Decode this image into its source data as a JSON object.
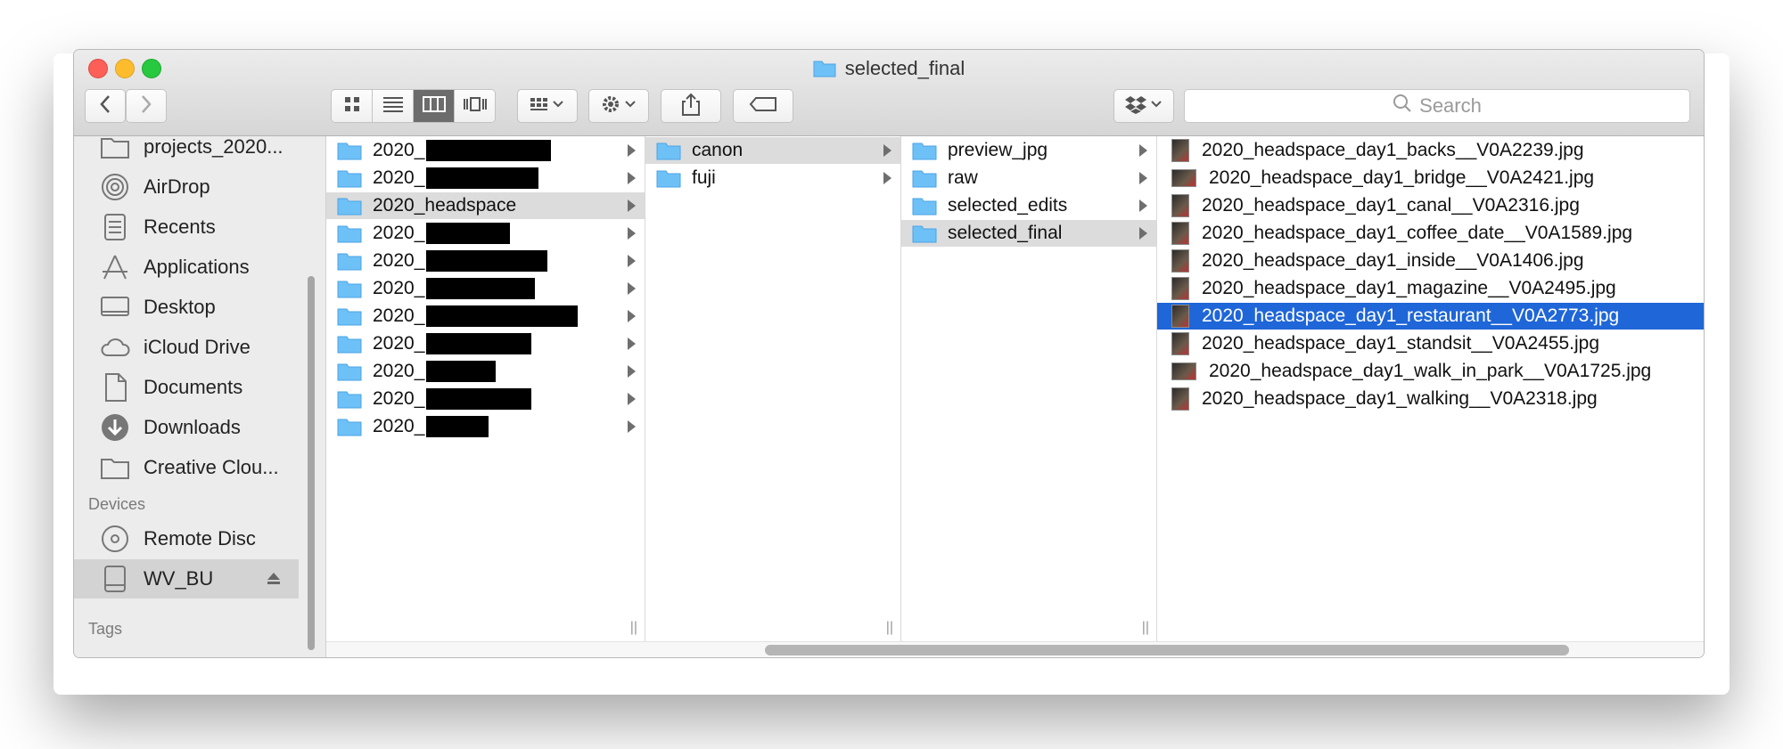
{
  "window": {
    "title": "selected_final"
  },
  "toolbar": {
    "back_icon": "chevron-left-icon",
    "forward_icon": "chevron-right-icon",
    "view_modes": [
      "icon-view-icon",
      "list-view-icon",
      "column-view-icon",
      "cover-flow-icon"
    ],
    "active_view": "column",
    "search_placeholder": "Search"
  },
  "sidebar": {
    "items": [
      {
        "label": "projects_2020...",
        "icon": "folder-icon"
      },
      {
        "label": "AirDrop",
        "icon": "airdrop-icon"
      },
      {
        "label": "Recents",
        "icon": "recents-icon"
      },
      {
        "label": "Applications",
        "icon": "applications-icon"
      },
      {
        "label": "Desktop",
        "icon": "desktop-icon"
      },
      {
        "label": "iCloud Drive",
        "icon": "cloud-icon"
      },
      {
        "label": "Documents",
        "icon": "documents-icon"
      },
      {
        "label": "Downloads",
        "icon": "downloads-icon"
      },
      {
        "label": "Creative Clou...",
        "icon": "folder-icon"
      }
    ],
    "devices_header": "Devices",
    "devices": [
      {
        "label": "Remote Disc",
        "icon": "disc-icon"
      },
      {
        "label": "WV_BU",
        "icon": "drive-icon",
        "selected": true
      }
    ],
    "tags_header": "Tags"
  },
  "columns": {
    "col1": [
      {
        "label": "2020_",
        "redacted": true
      },
      {
        "label": "2020_",
        "redacted": true
      },
      {
        "label": "2020_headspace",
        "highlighted": true
      },
      {
        "label": "2020_",
        "redacted": true
      },
      {
        "label": "2020_",
        "redacted": true
      },
      {
        "label": "2020_",
        "redacted": true
      },
      {
        "label": "2020_",
        "redacted": true
      },
      {
        "label": "2020_",
        "redacted": true
      },
      {
        "label": "2020_",
        "redacted": true
      },
      {
        "label": "2020_",
        "redacted": true
      },
      {
        "label": "2020_",
        "redacted": true
      }
    ],
    "col2": [
      {
        "label": "canon",
        "highlighted": true
      },
      {
        "label": "fuji"
      }
    ],
    "col3": [
      {
        "label": "preview_jpg"
      },
      {
        "label": "raw"
      },
      {
        "label": "selected_edits"
      },
      {
        "label": "selected_final",
        "highlighted": true
      }
    ],
    "col4": [
      {
        "label": "2020_headspace_day1_backs__V0A2239.jpg"
      },
      {
        "label": "2020_headspace_day1_bridge__V0A2421.jpg"
      },
      {
        "label": "2020_headspace_day1_canal__V0A2316.jpg"
      },
      {
        "label": "2020_headspace_day1_coffee_date__V0A1589.jpg"
      },
      {
        "label": "2020_headspace_day1_inside__V0A1406.jpg"
      },
      {
        "label": "2020_headspace_day1_magazine__V0A2495.jpg"
      },
      {
        "label": "2020_headspace_day1_restaurant__V0A2773.jpg",
        "selected": true
      },
      {
        "label": "2020_headspace_day1_standsit__V0A2455.jpg"
      },
      {
        "label": "2020_headspace_day1_walk_in_park__V0A1725.jpg"
      },
      {
        "label": "2020_headspace_day1_walking__V0A2318.jpg"
      }
    ]
  },
  "colors": {
    "selection": "#1f66d8",
    "highlight": "#dcdcdc",
    "folder": "#6ec1f7"
  }
}
